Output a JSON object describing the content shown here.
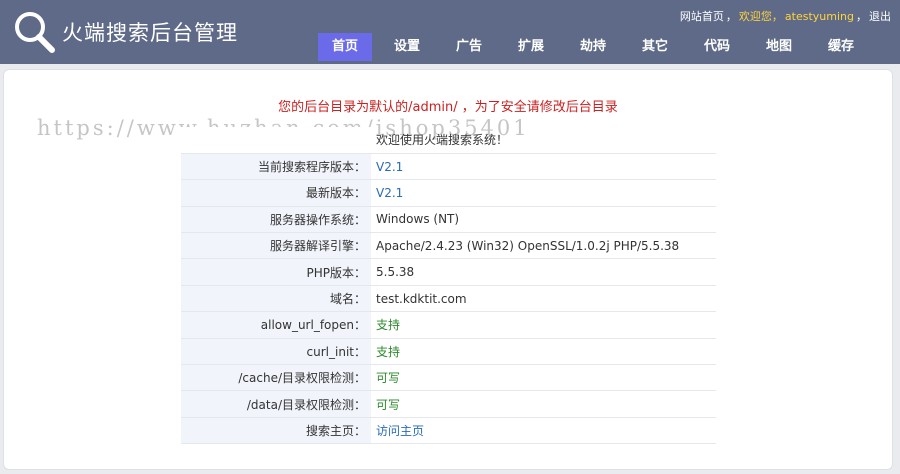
{
  "header": {
    "brand": "火端搜索后台管理",
    "top_links": {
      "home": "网站首页",
      "separator": "，",
      "welcome": "欢迎您，",
      "user": "atestyuming",
      "separator2": "，",
      "logout": "退出"
    },
    "nav": [
      {
        "label": "首页",
        "active": true
      },
      {
        "label": "设置",
        "active": false
      },
      {
        "label": "广告",
        "active": false
      },
      {
        "label": "扩展",
        "active": false
      },
      {
        "label": "劫持",
        "active": false
      },
      {
        "label": "其它",
        "active": false
      },
      {
        "label": "代码",
        "active": false
      },
      {
        "label": "地图",
        "active": false
      },
      {
        "label": "缓存",
        "active": false
      }
    ]
  },
  "main": {
    "warning": "您的后台目录为默认的/admin/ ，为了安全请修改后台目录",
    "watermark": "https://www.huzhan.com/ishop35401",
    "welcome_row": "欢迎使用火端搜索系统！",
    "rows": [
      {
        "label": "当前搜索程序版本：",
        "value": "V2.1",
        "style": "link"
      },
      {
        "label": "最新版本：",
        "value": "V2.1",
        "style": "link"
      },
      {
        "label": "服务器操作系统：",
        "value": "Windows (NT)",
        "style": "value"
      },
      {
        "label": "服务器解译引擎：",
        "value": "Apache/2.4.23 (Win32) OpenSSL/1.0.2j PHP/5.5.38",
        "style": "value"
      },
      {
        "label": "PHP版本：",
        "value": "5.5.38",
        "style": "value"
      },
      {
        "label": "域名：",
        "value": "test.kdktit.com",
        "style": "value"
      },
      {
        "label": "allow_url_fopen：",
        "value": "支持",
        "style": "green"
      },
      {
        "label": "curl_init：",
        "value": "支持",
        "style": "green"
      },
      {
        "label": "/cache/目录权限检测：",
        "value": "可写",
        "style": "green"
      },
      {
        "label": "/data/目录权限检测：",
        "value": "可写",
        "style": "green"
      },
      {
        "label": "搜索主页：",
        "value": "访问主页",
        "style": "link"
      }
    ]
  },
  "colors": {
    "header_bg": "#5e6a87",
    "nav_active": "#6b6ae8",
    "warning": "#cc1f1f",
    "link": "#2a6bb5",
    "ok_green": "#2c8a2c",
    "highlight_yellow": "#ffd33d"
  },
  "icons": {
    "logo": "magnifier-icon"
  }
}
